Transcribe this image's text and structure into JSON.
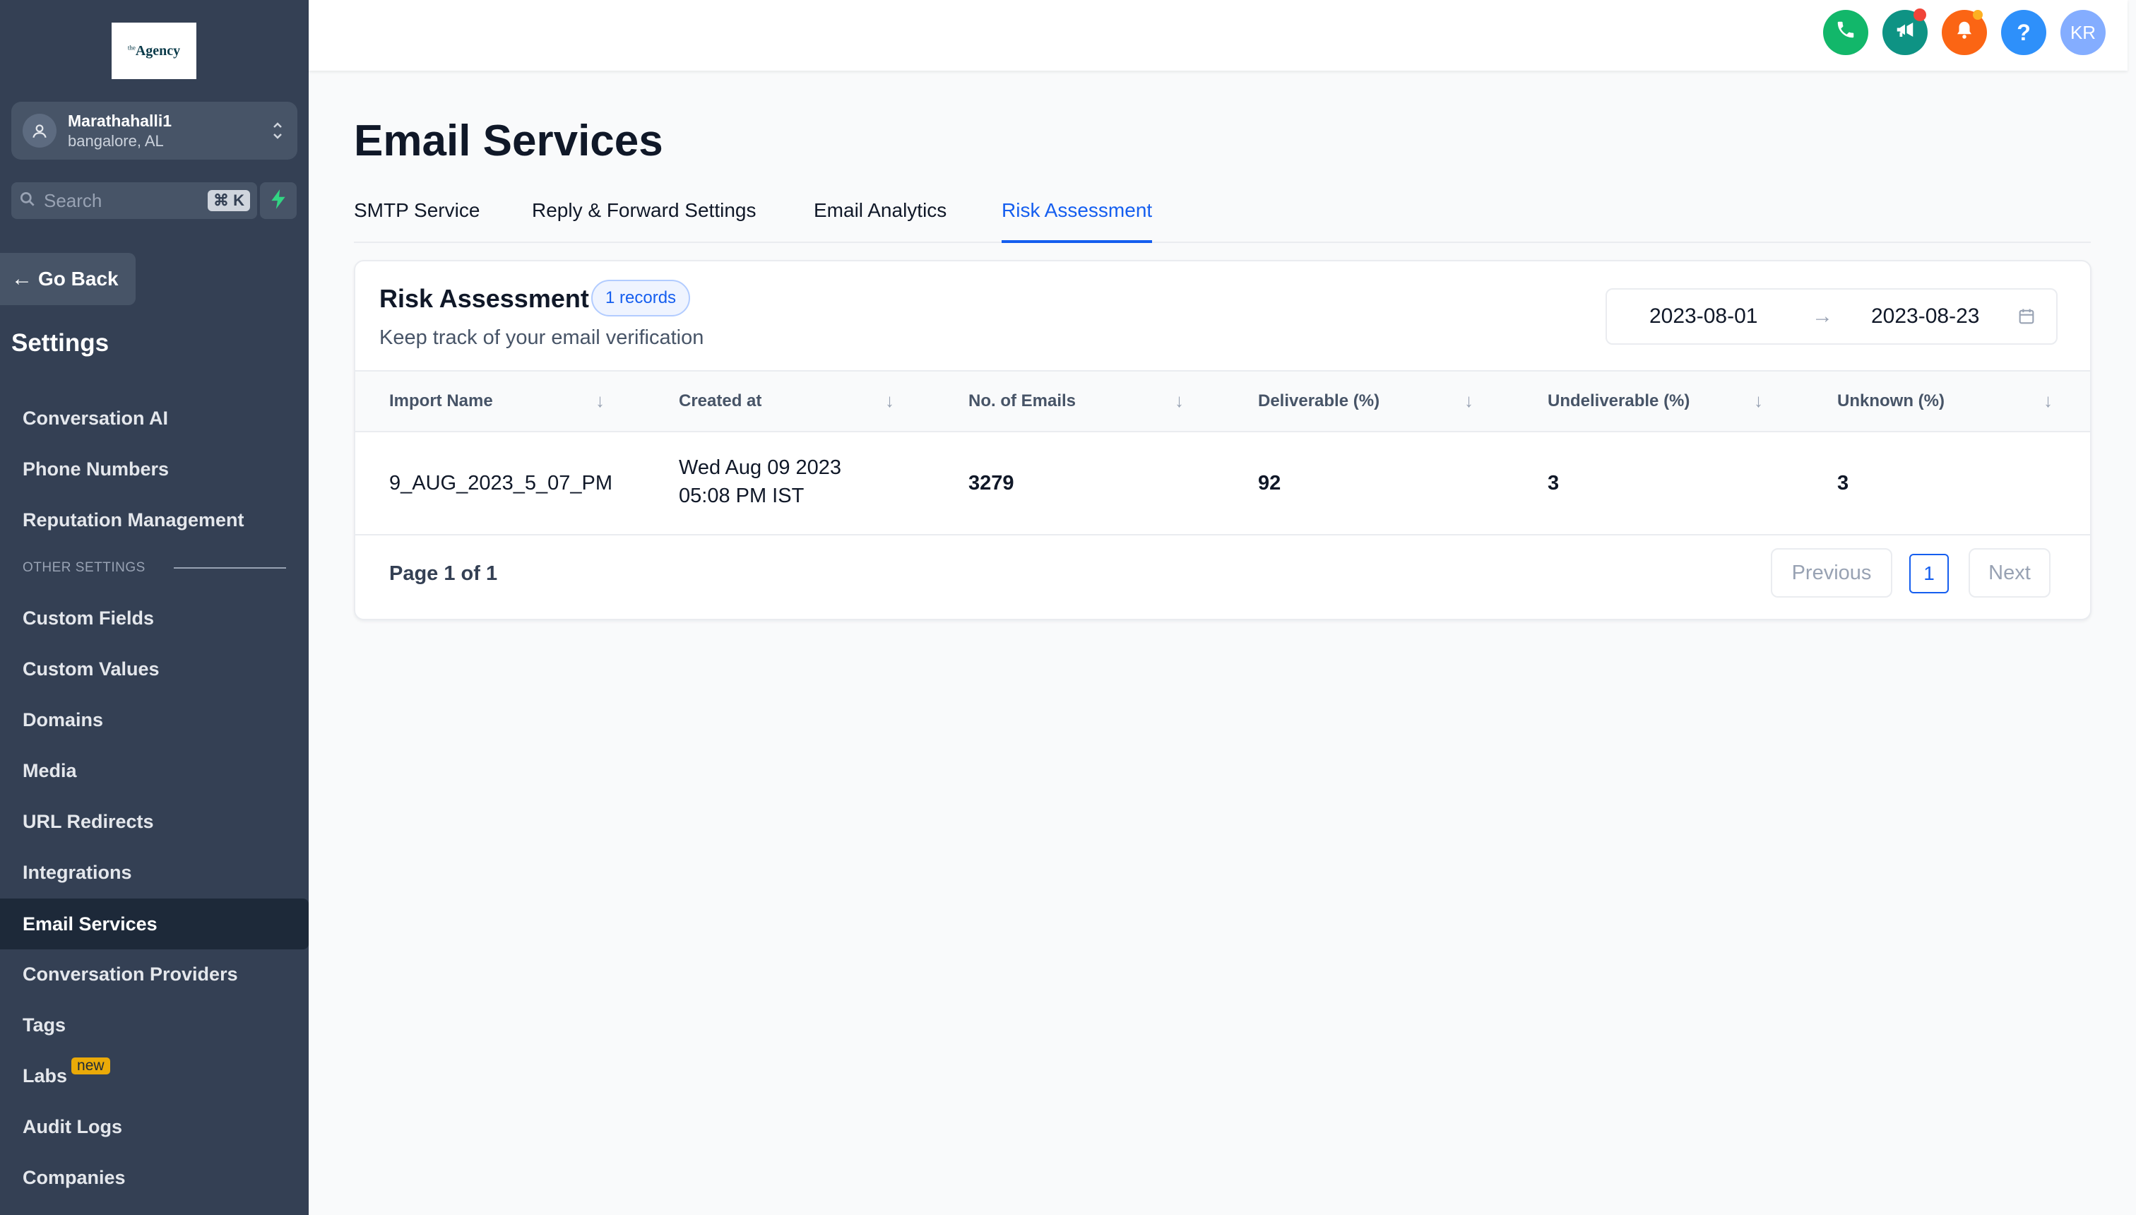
{
  "sidebar": {
    "logo_sup": "the",
    "logo": "Agency",
    "location": {
      "name": "Marathahalli1",
      "sub": "bangalore, AL"
    },
    "search_placeholder": "Search",
    "search_shortcut": "⌘ K",
    "go_back": "Go Back",
    "settings_title": "Settings",
    "nav_primary": [
      "Conversation AI",
      "Phone Numbers",
      "Reputation Management"
    ],
    "other_settings_label": "OTHER SETTINGS",
    "nav_secondary": [
      "Custom Fields",
      "Custom Values",
      "Domains",
      "Media",
      "URL Redirects",
      "Integrations",
      "Email Services",
      "Conversation Providers",
      "Tags",
      "Labs",
      "Audit Logs",
      "Companies"
    ],
    "labs_badge": "new",
    "active_item": "Email Services"
  },
  "header": {
    "avatar_initials": "KR",
    "help_glyph": "?",
    "icons": [
      "phone-icon",
      "megaphone-icon",
      "bell-icon",
      "help-icon",
      "user-avatar"
    ],
    "colors": {
      "phone": "#12b76a",
      "megaphone": "#0e9384",
      "bell": "#fb6514",
      "help": "#2e90fa",
      "avatar": "#84adff"
    }
  },
  "main": {
    "title": "Email Services",
    "tabs": [
      "SMTP Service",
      "Reply & Forward Settings",
      "Email Analytics",
      "Risk Assessment"
    ],
    "active_tab": "Risk Assessment",
    "card": {
      "title": "Risk Assessment",
      "badge": "1 records",
      "subtitle": "Keep track of your email verification",
      "date_from": "2023-08-01",
      "date_to": "2023-08-23",
      "columns": [
        "Import Name",
        "Created at",
        "No. of Emails",
        "Deliverable (%)",
        "Undeliverable (%)",
        "Unknown (%)"
      ],
      "rows": [
        {
          "import_name": "9_AUG_2023_5_07_PM",
          "created_line1": "Wed Aug 09 2023",
          "created_line2": "05:08 PM IST",
          "emails": "3279",
          "deliverable": "92",
          "undeliverable": "3",
          "unknown": "3"
        }
      ],
      "pagination": {
        "info": "Page 1 of 1",
        "previous": "Previous",
        "current": "1",
        "next": "Next"
      }
    }
  },
  "accent_color": "#155eef"
}
